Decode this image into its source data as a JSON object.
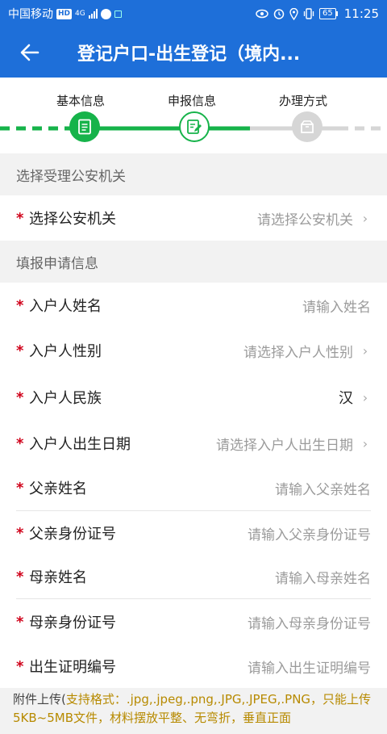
{
  "status_bar": {
    "carrier": "中国移动",
    "hd": "HD",
    "network": "4G",
    "battery": "65",
    "time": "11:25"
  },
  "header": {
    "title": "登记户口-出生登记（境内..."
  },
  "steps": [
    {
      "label": "基本信息",
      "state": "done"
    },
    {
      "label": "申报信息",
      "state": "active"
    },
    {
      "label": "办理方式",
      "state": "pending"
    }
  ],
  "colors": {
    "brand_blue": "#1e6fd9",
    "step_green": "#16b34a",
    "required_red": "#d0021b",
    "hint_gold": "#b78a00"
  },
  "sections": {
    "police": {
      "title": "选择受理公安机关",
      "fields": [
        {
          "label": "选择公安机关",
          "placeholder": "请选择公安机关",
          "type": "select"
        }
      ]
    },
    "apply": {
      "title": "填报申请信息",
      "fields": [
        {
          "label": "入户人姓名",
          "placeholder": "请输入姓名",
          "type": "input"
        },
        {
          "label": "入户人性别",
          "placeholder": "请选择入户人性别",
          "type": "select"
        },
        {
          "label": "入户人民族",
          "value": "汉",
          "type": "select"
        },
        {
          "label": "入户人出生日期",
          "placeholder": "请选择入户人出生日期",
          "type": "select"
        },
        {
          "label": "父亲姓名",
          "placeholder": "请输入父亲姓名",
          "type": "input"
        },
        {
          "label": "父亲身份证号",
          "placeholder": "请输入父亲身份证号",
          "type": "input"
        },
        {
          "label": "母亲姓名",
          "placeholder": "请输入母亲姓名",
          "type": "input"
        },
        {
          "label": "母亲身份证号",
          "placeholder": "请输入母亲身份证号",
          "type": "input"
        },
        {
          "label": "出生证明编号",
          "placeholder": "请输入出生证明编号",
          "type": "input"
        }
      ]
    }
  },
  "upload": {
    "label": "附件上传(",
    "hint": "支持格式：.jpg,.jpeg,.png,.JPG,.JPEG,.PNG，只能上传5KB~5MB文件，材料摆放平整、无弯折，垂直正面"
  },
  "required_mark": "*"
}
